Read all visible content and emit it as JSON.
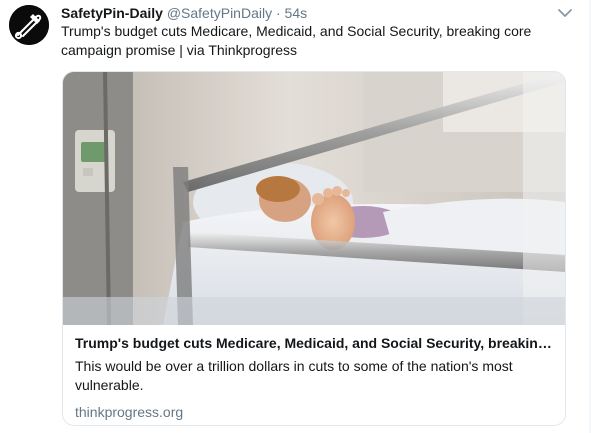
{
  "tweet": {
    "author_name": "SafetyPin-Daily",
    "author_handle": "@SafetyPinDaily",
    "separator": "·",
    "timestamp": "54s",
    "avatar_icon": "safety-pin-logo",
    "text": "Trump's budget cuts Medicare, Medicaid, and Social Security, breaking core campaign promise | via Thinkprogress",
    "menu_icon": "chevron-down-icon"
  },
  "card": {
    "image_description_icon": "hospital-bed-photo",
    "title": "Trump's budget cuts Medicare, Medicaid, and Social Security, breaking core campaign promise",
    "description": "This would be over a trillion dollars in cuts to some of the nation's most vulnerable.",
    "domain": "thinkprogress.org"
  },
  "colors": {
    "text_primary": "#14171a",
    "text_secondary": "#657786",
    "border": "#e1e8ed"
  }
}
